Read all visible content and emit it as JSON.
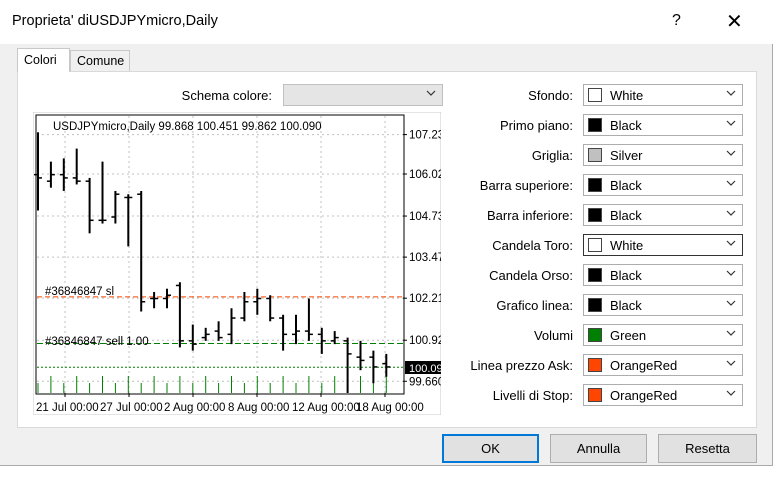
{
  "dialog": {
    "title": "Proprieta' diUSDJPYmicro,Daily",
    "help": "?",
    "close": "✕"
  },
  "tabs": [
    {
      "label": "Colori",
      "active": true
    },
    {
      "label": "Comune",
      "active": false
    }
  ],
  "color_scheme": {
    "label": "Schema colore:",
    "value": ""
  },
  "properties": [
    {
      "label": "Sfondo:",
      "value": "White",
      "swatch": "#ffffff"
    },
    {
      "label": "Primo piano:",
      "value": "Black",
      "swatch": "#000000"
    },
    {
      "label": "Griglia:",
      "value": "Silver",
      "swatch": "#c0c0c0"
    },
    {
      "label": "Barra superiore:",
      "value": "Black",
      "swatch": "#000000"
    },
    {
      "label": "Barra inferiore:",
      "value": "Black",
      "swatch": "#000000"
    },
    {
      "label": "Candela Toro:",
      "value": "White",
      "swatch": "#ffffff"
    },
    {
      "label": "Candela Orso:",
      "value": "Black",
      "swatch": "#000000"
    },
    {
      "label": "Grafico linea:",
      "value": "Black",
      "swatch": "#000000"
    },
    {
      "label": "Volumi",
      "value": "Green",
      "swatch": "#008000"
    },
    {
      "label": "Linea prezzo Ask:",
      "value": "OrangeRed",
      "swatch": "#ff4500"
    },
    {
      "label": "Livelli di Stop:",
      "value": "OrangeRed",
      "swatch": "#ff4500"
    }
  ],
  "buttons": {
    "ok": "OK",
    "cancel": "Annulla",
    "reset": "Resetta"
  },
  "preview": {
    "header": "USDJPYmicro,Daily  99.868 100.451 99.862 100.090",
    "sl_label": "#36846847 sl",
    "sell_label": "#36846847 sell 1.00",
    "price_levels": [
      "107.230",
      "106.020",
      "104.730",
      "103.470",
      "102.210",
      "100.920",
      "99.660"
    ],
    "current_price": "100.090",
    "date_labels": [
      "21 Jul 00:00",
      "27 Jul 00:00",
      "2 Aug 00:00",
      "8 Aug 00:00",
      "12 Aug 00:00",
      "18 Aug 00:00"
    ]
  },
  "chart_data": {
    "type": "candlestick",
    "ylim": [
      99.3,
      107.8
    ],
    "sl_level": 102.25,
    "sell_level": 100.82,
    "ask_level": 100.09,
    "bars": [
      {
        "o": 106.0,
        "h": 107.3,
        "l": 104.9,
        "c": 105.9
      },
      {
        "o": 105.8,
        "h": 106.4,
        "l": 105.6,
        "c": 106.0
      },
      {
        "o": 106.0,
        "h": 106.5,
        "l": 105.5,
        "c": 105.9
      },
      {
        "o": 105.9,
        "h": 106.8,
        "l": 105.7,
        "c": 105.8
      },
      {
        "o": 105.8,
        "h": 105.9,
        "l": 104.2,
        "c": 104.6
      },
      {
        "o": 104.6,
        "h": 106.4,
        "l": 104.5,
        "c": 104.6
      },
      {
        "o": 104.7,
        "h": 105.5,
        "l": 104.5,
        "c": 105.4
      },
      {
        "o": 105.3,
        "h": 105.4,
        "l": 103.8,
        "c": 105.3
      },
      {
        "o": 105.4,
        "h": 105.5,
        "l": 101.8,
        "c": 102.1
      },
      {
        "o": 102.2,
        "h": 102.4,
        "l": 101.9,
        "c": 102.2
      },
      {
        "o": 102.2,
        "h": 102.5,
        "l": 101.9,
        "c": 102.3
      },
      {
        "o": 102.6,
        "h": 102.7,
        "l": 100.7,
        "c": 100.9
      },
      {
        "o": 100.9,
        "h": 101.4,
        "l": 100.6,
        "c": 100.8
      },
      {
        "o": 101.0,
        "h": 101.3,
        "l": 100.9,
        "c": 101.1
      },
      {
        "o": 101.2,
        "h": 101.5,
        "l": 100.9,
        "c": 101.0
      },
      {
        "o": 101.1,
        "h": 101.9,
        "l": 100.8,
        "c": 101.6
      },
      {
        "o": 101.6,
        "h": 102.4,
        "l": 101.5,
        "c": 102.1
      },
      {
        "o": 102.1,
        "h": 102.5,
        "l": 101.7,
        "c": 102.2
      },
      {
        "o": 102.2,
        "h": 102.3,
        "l": 101.5,
        "c": 101.6
      },
      {
        "o": 101.6,
        "h": 101.7,
        "l": 100.6,
        "c": 101.1
      },
      {
        "o": 101.1,
        "h": 101.7,
        "l": 100.8,
        "c": 101.2
      },
      {
        "o": 101.2,
        "h": 102.2,
        "l": 100.9,
        "c": 101.1
      },
      {
        "o": 101.1,
        "h": 101.3,
        "l": 100.5,
        "c": 100.9
      },
      {
        "o": 100.9,
        "h": 101.2,
        "l": 100.8,
        "c": 101.0
      },
      {
        "o": 100.9,
        "h": 101.0,
        "l": 99.3,
        "c": 100.5
      },
      {
        "o": 100.4,
        "h": 100.9,
        "l": 100.0,
        "c": 100.3
      },
      {
        "o": 100.4,
        "h": 100.6,
        "l": 99.6,
        "c": 100.1
      },
      {
        "o": 100.2,
        "h": 100.5,
        "l": 99.8,
        "c": 100.1
      }
    ]
  }
}
